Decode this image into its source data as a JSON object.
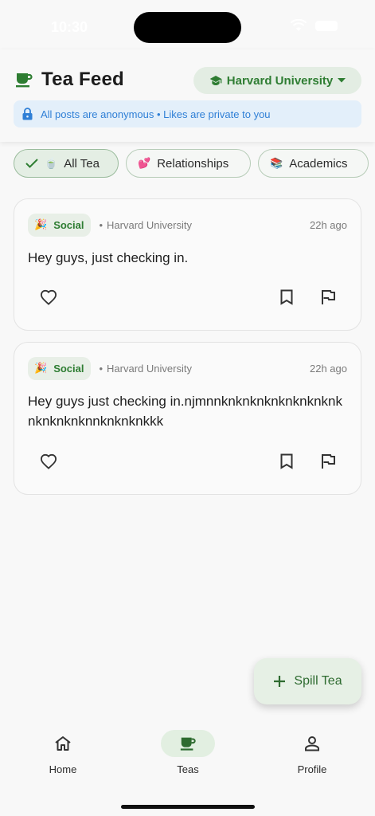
{
  "status_bar": {
    "time": "10:30"
  },
  "header": {
    "title": "Tea Feed",
    "school": "Harvard University",
    "banner": "All posts are anonymous • Likes are private to you"
  },
  "filters": [
    {
      "label": "All Tea",
      "emoji": "🍵",
      "selected": true
    },
    {
      "label": "Relationships",
      "emoji": "💕",
      "selected": false
    },
    {
      "label": "Academics",
      "emoji": "📚",
      "selected": false
    }
  ],
  "posts": [
    {
      "category": "Social",
      "category_emoji": "🎉",
      "school": "Harvard University",
      "time": "22h ago",
      "text": "Hey guys, just checking in."
    },
    {
      "category": "Social",
      "category_emoji": "🎉",
      "school": "Harvard University",
      "time": "22h ago",
      "text": "Hey guys just checking in.njmnnknknknknknknknknknknknknknnknknknkkk"
    }
  ],
  "fab": {
    "label": "Spill Tea"
  },
  "nav": [
    {
      "label": "Home",
      "icon": "home-icon"
    },
    {
      "label": "Teas",
      "icon": "cup-icon"
    },
    {
      "label": "Profile",
      "icon": "person-icon"
    }
  ],
  "colors": {
    "accent": "#2e7d32",
    "info": "#2f7fd6"
  }
}
